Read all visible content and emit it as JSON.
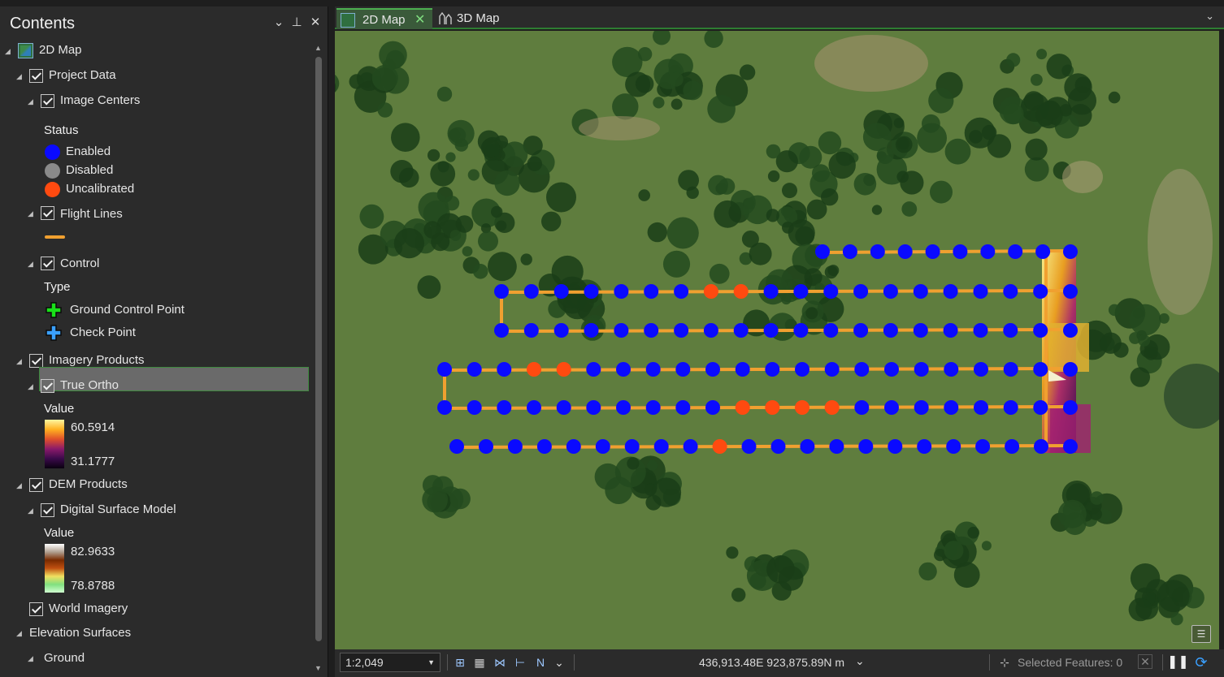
{
  "contents": {
    "title": "Contents",
    "header_buttons": {
      "menu": "⌄",
      "pin": "⊥",
      "close": "✕"
    }
  },
  "tree": {
    "map": "2D Map",
    "project_data": "Project Data",
    "image_centers": "Image Centers",
    "status_heading": "Status",
    "status_items": [
      {
        "label": "Enabled",
        "color": "#0a0aff"
      },
      {
        "label": "Disabled",
        "color": "#8a8a8a"
      },
      {
        "label": "Uncalibrated",
        "color": "#ff4a10"
      }
    ],
    "flight_lines": "Flight Lines",
    "flight_line_color": "#f0a030",
    "control": "Control",
    "type_heading": "Type",
    "control_items": [
      {
        "label": "Ground Control Point",
        "color": "#19e019"
      },
      {
        "label": "Check Point",
        "color": "#3aa0ff"
      }
    ],
    "imagery_products": "Imagery Products",
    "true_ortho": "True Ortho",
    "value_heading": "Value",
    "ortho_max": "60.5914",
    "ortho_min": "31.1777",
    "dem_products": "DEM Products",
    "dsm": "Digital Surface Model",
    "dsm_value_heading": "Value",
    "dsm_max": "82.9633",
    "dsm_min": "78.8788",
    "world_imagery": "World Imagery",
    "elevation_surfaces": "Elevation Surfaces",
    "ground": "Ground"
  },
  "tabs": [
    {
      "label": "2D Map",
      "active": true
    },
    {
      "label": "3D Map",
      "active": false
    }
  ],
  "status_bar": {
    "scale": "1:2,049",
    "coordinates": "436,913.48E 923,875.89N m",
    "selected_features": "Selected Features: 0"
  },
  "colors": {
    "enabled": "#0a0aff",
    "uncalibrated": "#ff4a10",
    "flight_line": "#f0a030",
    "accent": "#4caf50"
  }
}
